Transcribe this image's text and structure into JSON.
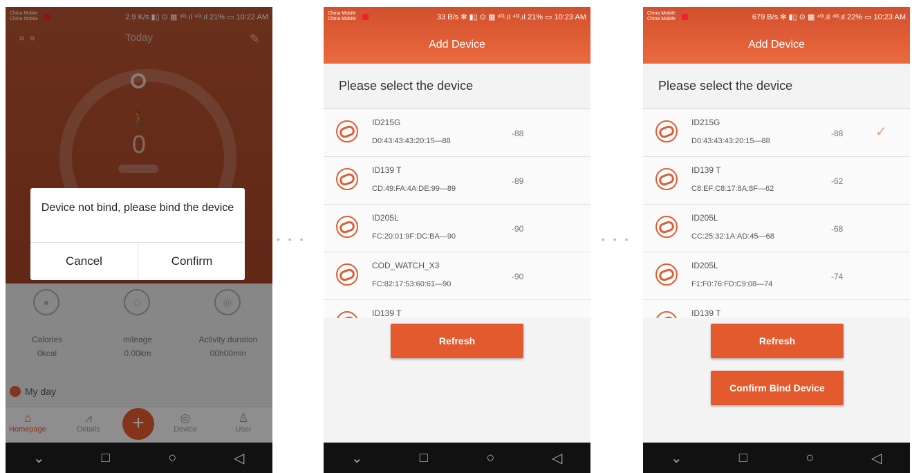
{
  "phone1": {
    "status": {
      "carrier": "China Mobile China Mobile",
      "right": "2.9 K/s ▮▯ ⊙ ▦ ⁴ᴳ.ıl ⁴ᴳ.ıl 21% ▭ 10:22 AM"
    },
    "header": {
      "title": "Today"
    },
    "steps": "0",
    "dialog": {
      "message": "Device not bind, please bind the device",
      "cancel": "Cancel",
      "confirm": "Confirm"
    },
    "stats": [
      {
        "label": "Calories",
        "value": "0kcal"
      },
      {
        "label": "mileage",
        "value": "0.00km"
      },
      {
        "label": "Activity duration",
        "value": "00h00min"
      }
    ],
    "myday": "My day",
    "tabs": [
      {
        "label": "Homepage",
        "icon": "⌂"
      },
      {
        "label": "Details",
        "icon": "⩘"
      },
      {
        "label": "Device",
        "icon": "◎"
      },
      {
        "label": "User",
        "icon": "♙"
      }
    ],
    "plus": "+"
  },
  "phone2": {
    "status": {
      "carrier": "China Mobile China Mobile",
      "right": "33 B/s ✻ ▮▯ ⊙ ▦ ⁴ᴳ.ıl ⁴ᴳ.ıl 21% ▭ 10:23 AM"
    },
    "title": "Add Device",
    "select_title": "Please select the device",
    "devices": [
      {
        "name": "ID215G",
        "mac": "D0:43:43:43:20:15—88",
        "rssi": "-88"
      },
      {
        "name": "ID139 T",
        "mac": "CD:49:FA:4A:DE:99—89",
        "rssi": "-89"
      },
      {
        "name": "ID205L",
        "mac": "FC:20:01:9F:DC:BA—90",
        "rssi": "-90"
      },
      {
        "name": "COD_WATCH_X3",
        "mac": "FC:82:17:53:60:61—90",
        "rssi": "-90"
      },
      {
        "name": "ID139 T",
        "mac": "",
        "rssi": ""
      }
    ],
    "refresh": "Refresh"
  },
  "phone3": {
    "status": {
      "carrier": "China Mobile China Mobile",
      "right": "679 B/s ✻ ▮▯ ⊙ ▦ ⁴ᴳ.ıl ⁴ᴳ.ıl 22% ▭ 10:23 AM"
    },
    "title": "Add Device",
    "select_title": "Please select the device",
    "devices": [
      {
        "name": "ID215G",
        "mac": "D0:43:43:43:20:15—88",
        "rssi": "-88",
        "check": "✓"
      },
      {
        "name": "ID139 T",
        "mac": "C8:EF:C8:17:8A:8F—62",
        "rssi": "-62"
      },
      {
        "name": "ID205L",
        "mac": "CC:25:32:1A:AD:45—68",
        "rssi": "-68"
      },
      {
        "name": "ID205L",
        "mac": "F1:F0:76:FD:C9:08—74",
        "rssi": "-74"
      },
      {
        "name": "ID139 T",
        "mac": "",
        "rssi": ""
      }
    ],
    "refresh": "Refresh",
    "confirm_bind": "Confirm Bind Device"
  },
  "navbar": {
    "back": "⌄",
    "home": "□",
    "recent": "○",
    "nav": "◁"
  },
  "separators": {
    "dots": "• • •"
  }
}
